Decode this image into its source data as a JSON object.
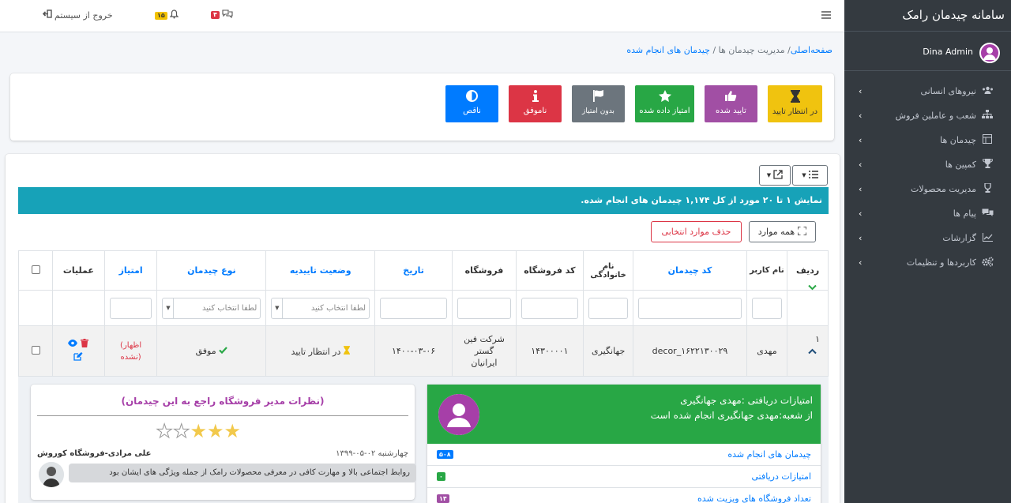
{
  "topbar": {
    "logout_label": "خروج از سیستم",
    "notifications_count": "۱۵",
    "messages_count": "۴",
    "menu_icon": "hamburger-icon"
  },
  "sidebar": {
    "brand": "سامانه چیدمان رامک",
    "user_name": "Dina Admin",
    "items": [
      {
        "label": "نیروهای انسانی",
        "icon": "users-icon"
      },
      {
        "label": "شعب و عاملین فروش",
        "icon": "sitemap-icon"
      },
      {
        "label": "چیدمان ها",
        "icon": "layout-icon"
      },
      {
        "label": "کمپین ها",
        "icon": "trophy-icon"
      },
      {
        "label": "مدیریت محصولات",
        "icon": "award-icon"
      },
      {
        "label": "پیام ها",
        "icon": "chat-icon"
      },
      {
        "label": "گزارشات",
        "icon": "chart-icon"
      },
      {
        "label": "کاربردها و تنظیمات",
        "icon": "cogs-icon"
      }
    ]
  },
  "breadcrumb": {
    "home": "صفحه‌اصلی",
    "section": "مدیریت چیدمان ها",
    "current": "چیدمان های انجام شده"
  },
  "status_buttons": [
    {
      "label": "در انتظار تایید",
      "color": "#f0c30f",
      "icon": "hourglass-icon"
    },
    {
      "label": "تایید شده",
      "color": "#a14fa4",
      "icon": "thumbs-up-icon"
    },
    {
      "label": "امتیاز داده شده",
      "color": "#28a745",
      "icon": "star-icon"
    },
    {
      "label": "بدون امتیاز",
      "color": "#6c757d",
      "icon": "flag-icon"
    },
    {
      "label": "ناموفق",
      "color": "#dc3545",
      "icon": "info-icon"
    },
    {
      "label": "ناقص",
      "color": "#007bff",
      "icon": "half-circle-icon"
    }
  ],
  "info_bar": {
    "text": "نمایش ۱ تا ۲۰ مورد از کل ۱,۱۷۴ چیدمان های انجام شده."
  },
  "actions": {
    "delete_selected": "حذف موارد انتخابی",
    "select_all": "همه موارد"
  },
  "table": {
    "headers": {
      "row": "ردیف",
      "layout_code": "کد چیدمان",
      "user_name": "نام کاربر",
      "family": "نام خانوادگی",
      "store_code": "کد فروشگاه",
      "store": "فروشگاه",
      "date": "تاریخ",
      "approval": "وضعیت تاییدیه",
      "layout_type": "نوع چیدمان",
      "score": "امتیاز",
      "operations": "عملیات"
    },
    "select_placeholder": "لطفا انتخاب کنید",
    "row": {
      "num": "۱",
      "layout_code": "decor_۱۶۲۲۱۳۰۰۲۹",
      "user_name": "مهدی",
      "family": "جهانگیری",
      "store_code": "۱۴۳۰۰۰۰۱",
      "store": "شرکت فین گستر ایرانیان",
      "date": "۱۴۰۰-۰۳-۰۶",
      "approval": "در انتظار تایید",
      "layout_type": "موفق",
      "score": "(اظهار نشده)"
    }
  },
  "review": {
    "title": "(نظرات مدیر فروشگاه راجع به این چیدمان)",
    "stars_filled": 3,
    "stars_total": 5,
    "date": "چهارشنبه ۰۲-۰۵-۱۳۹۹",
    "author": "علی مرادی-فروشگاه کوروش",
    "text": "روابط اجتماعی بالا و مهارت کافی در معرفی محصولات رامک از جمله ویژگی های ایشان بود"
  },
  "worker": {
    "name_line": "امتیازات دریافتی :مهدی جهانگیری",
    "branch_line": "از شعبه:مهدی جهانگیری انجام شده است",
    "stats": [
      {
        "label": "چیدمان های انجام شده",
        "badge": "۵۰۸",
        "color": "#007bff"
      },
      {
        "label": "امتیازات دریافتی",
        "badge": "۰",
        "color": "#28a745"
      },
      {
        "label": "تعداد فروشگاه های ویزیت شده",
        "badge": "۱۴",
        "color": "#a14fa4"
      }
    ]
  }
}
